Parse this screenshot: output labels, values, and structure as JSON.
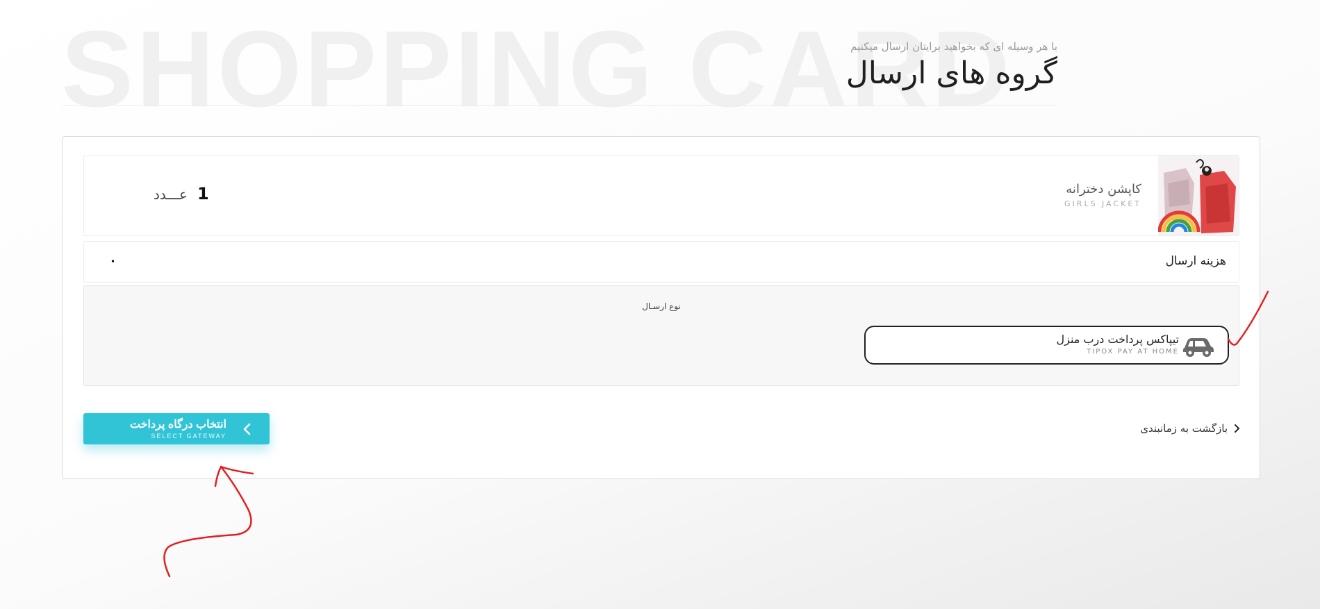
{
  "watermark": "SHOPPING CARD",
  "header": {
    "subtitle": "با هر وسیله ای که بخواهید برایتان ارسال میکنیم",
    "title": "گروه های ارسال"
  },
  "product": {
    "name": "کاپشن دخترانه",
    "name_en": "GIRLS JACKET",
    "quantity": "1",
    "quantity_unit": "عـــدد"
  },
  "shipping": {
    "label": "هزینه ارسال",
    "value": "۰"
  },
  "method": {
    "title": "نوع ارسـال",
    "option": {
      "name": "تیپاکس پرداخت درب منزل",
      "name_en": "TIPOX PAY AT HOME",
      "icon": "car-icon"
    }
  },
  "actions": {
    "gateway_label": "انتخاب درگاه پرداخت",
    "gateway_sub": "SELECT GATEWAY",
    "back_label": "بازگشت به زمانبندی"
  },
  "colors": {
    "accent": "#30c4d6",
    "annotation": "#e02020"
  }
}
